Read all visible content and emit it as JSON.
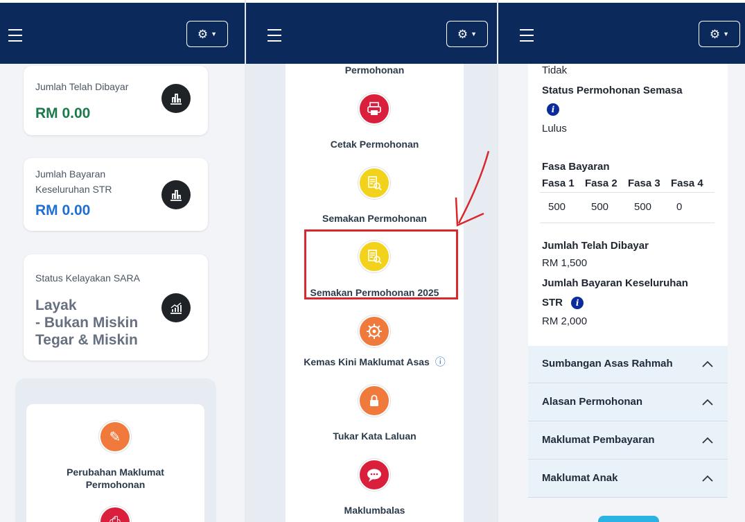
{
  "panel1": {
    "cards": [
      {
        "label": "Jumlah Telah Dibayar",
        "amount": "RM 0.00",
        "amount_color": "#1b7a4a"
      },
      {
        "label_line1": "Jumlah Bayaran",
        "label_line2": "Keseluruhan STR",
        "amount": "RM 0.00",
        "amount_color": "#1f6fd1"
      }
    ],
    "status_card": {
      "label": "Status Kelayakan SARA",
      "lines": [
        "Layak",
        "- Bukan Miskin",
        "Tegar & Miskin"
      ]
    },
    "service": {
      "label_line1": "Perubahan Maklumat",
      "label_line2": "Permohonan"
    }
  },
  "panel2": {
    "partial_label": "Permohonan",
    "services": [
      {
        "label": "Cetak Permohonan",
        "icon": "printer-icon",
        "color": "#d91f3c"
      },
      {
        "label": "Semakan Permohonan",
        "icon": "document-search-icon",
        "color": "#f2d21b"
      },
      {
        "label": "Semakan Permohonan 2025",
        "icon": "document-search-icon",
        "color": "#f2d21b"
      },
      {
        "label": "Kemas Kini Maklumat Asas",
        "icon": "gear-icon",
        "color": "#f07a3c"
      },
      {
        "label": "Tukar Kata Laluan",
        "icon": "lock-icon",
        "color": "#f07a3c"
      },
      {
        "label": "Maklumbalas",
        "icon": "chat-icon",
        "color": "#d91f3c"
      }
    ],
    "info_glyph": "ⓘ"
  },
  "panel3": {
    "value_tidak": "Tidak",
    "status_label": "Status Permohonan Semasa",
    "status_value": "Lulus",
    "fasa_title": "Fasa Bayaran",
    "fasa_headers": [
      "Fasa 1",
      "Fasa 2",
      "Fasa 3",
      "Fasa 4"
    ],
    "fasa_values": [
      "500",
      "500",
      "500",
      "0"
    ],
    "paid_label": "Jumlah Telah Dibayar",
    "paid_value": "RM 1,500",
    "total_label_line1": "Jumlah Bayaran Keseluruhan",
    "total_label_line2": "STR",
    "total_value": "RM 2,000",
    "accordions": [
      "Sumbangan Asas Rahmah",
      "Alasan Permohonan",
      "Maklumat Pembayaran",
      "Maklumat Anak"
    ]
  },
  "colors": {
    "topbar": "#0b2a5b",
    "highlight_red": "#d9272e",
    "accordion_bg": "#e9f1f9"
  },
  "info_letter": "i"
}
